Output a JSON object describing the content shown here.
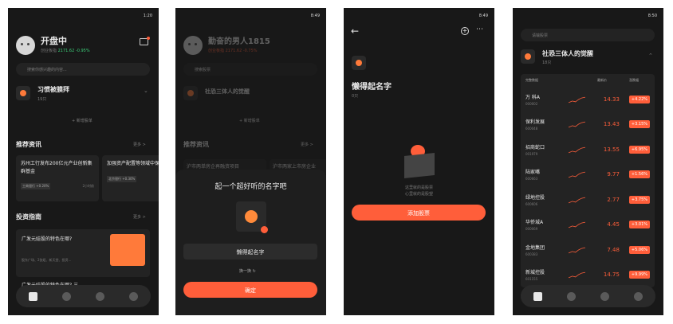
{
  "p1": {
    "time": "1:20",
    "title": "开盘中",
    "sub_label": "创业板指",
    "index_val": "2171.62",
    "index_chg": "-0.95%",
    "search_ph": "搜索你感兴趣的内容...",
    "group_name": "习惯被膜拜",
    "group_count": "19只",
    "add_stock": "+ 新增股单",
    "news_head": "推荐资讯",
    "more": "更多 >",
    "news1": "苏州工行发布200亿元产业创新集群基金",
    "news1_tag": "工商银行 +0.20%",
    "news1_time": "2小时前",
    "news2": "加强资产配置等领域中保投资公司与北京",
    "news2_tag": "北京银行 +0.30%",
    "guide_head": "投资指南",
    "guide1": "广发元娃股的特色在哪?",
    "guide1_sub": "股东广场、2张妞、新天堂、投资...",
    "guide2": "广发元娃股的特色在哪? 三"
  },
  "p2": {
    "time": "8:49",
    "title": "勤奋的男人1815",
    "sub": "创业板指 2171.62 -0.75%",
    "search_ph": "搜索股票",
    "group_name": "社恐三体人的觉醒",
    "add": "+ 新增股单",
    "news_head": "推荐资讯",
    "more": "更多 >",
    "n1": "沪市两单房企再融资项目",
    "n2": "沪市两家上市房企业",
    "sheet_title": "起一个超好听的名字吧",
    "name_val": "懒得起名字",
    "refresh": "换一换",
    "confirm": "确定"
  },
  "p3": {
    "time": "8:49",
    "title": "懒得起名字",
    "count": "0只",
    "empty1": "这里就的是股票",
    "empty2": "心里就的是股望",
    "add_btn": "添加股票"
  },
  "p4": {
    "time": "8:50",
    "search_ph": "请输股票",
    "group_name": "社恐三体人的觉醒",
    "group_count": "18只",
    "col_name": "完整数据",
    "col_price": "最新价",
    "col_chg": "涨跌幅",
    "stocks": [
      {
        "name": "万 科A",
        "code": "000002",
        "price": "14.33",
        "chg": "+4.22%"
      },
      {
        "name": "保利发展",
        "code": "600048",
        "price": "13.43",
        "chg": "+3.15%"
      },
      {
        "name": "招商蛇口",
        "code": "001979",
        "price": "13.55",
        "chg": "+6.95%"
      },
      {
        "name": "陆家嘴",
        "code": "600663",
        "price": "9.77",
        "chg": "+1.56%"
      },
      {
        "name": "绿地控股",
        "code": "600606",
        "price": "2.77",
        "chg": "+3.75%"
      },
      {
        "name": "华侨城A",
        "code": "000069",
        "price": "4.45",
        "chg": "+3.01%"
      },
      {
        "name": "金地集团",
        "code": "600383",
        "price": "7.48",
        "chg": "+5.06%"
      },
      {
        "name": "新城控股",
        "code": "601155",
        "price": "14.75",
        "chg": "+9.99%"
      }
    ]
  },
  "colors": {
    "accent": "#ff5e3a",
    "bg": "#181818",
    "up": "#ff5e3a",
    "down": "#3cd07a"
  }
}
